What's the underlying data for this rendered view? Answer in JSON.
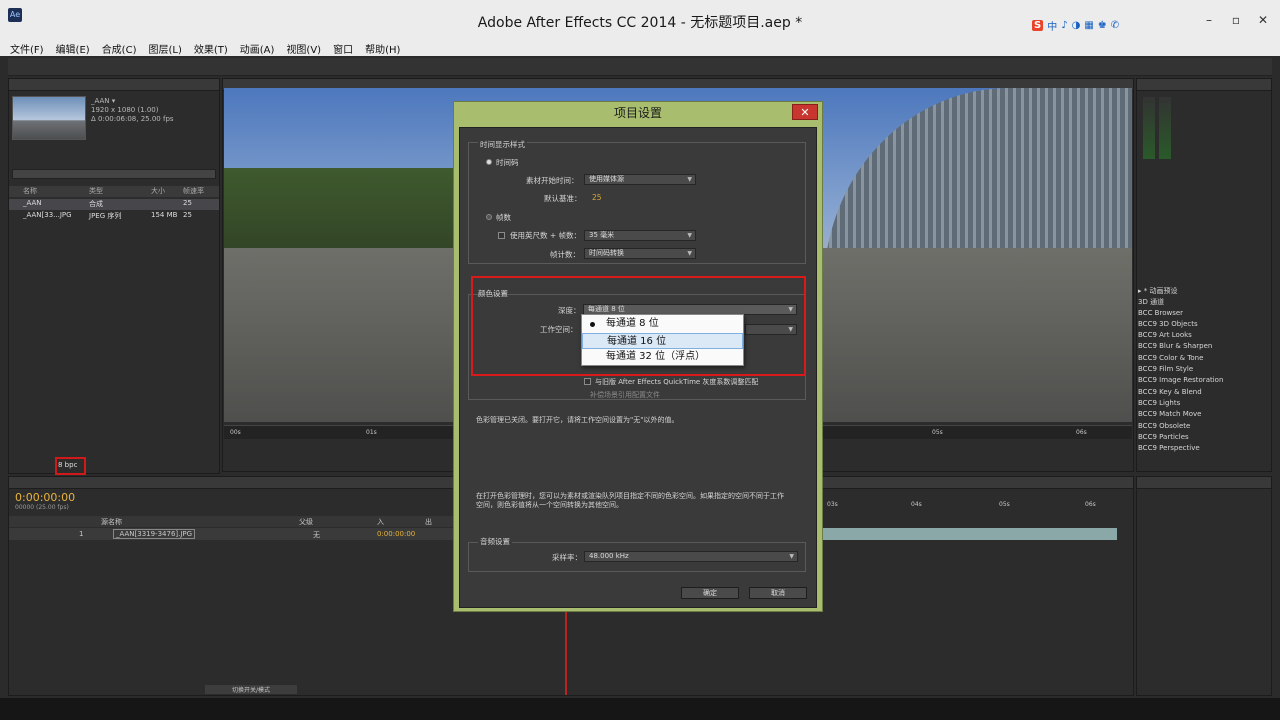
{
  "window": {
    "title": "Adobe After Effects CC 2014 - 无标题项目.aep *",
    "app_icon": "Ae"
  },
  "ime": [
    "S",
    "中",
    "♪",
    "◑",
    "▦",
    "♚",
    "✆"
  ],
  "menu": [
    "文件(F)",
    "编辑(E)",
    "合成(C)",
    "图层(L)",
    "效果(T)",
    "动画(A)",
    "视图(V)",
    "窗口",
    "帮助(H)"
  ],
  "project": {
    "item_name": "_AAN ▾",
    "item_dims": "1920 x 1080 (1.00)",
    "item_dur": "Δ 0:00:06:08, 25.00 fps",
    "columns": [
      "名称",
      "类型",
      "大小",
      "帧速率"
    ],
    "rows": [
      {
        "name": "_AAN",
        "type": "合成",
        "size": "",
        "fps": "25"
      },
      {
        "name": "_AAN[33...JPG",
        "type": "JPEG 序列",
        "size": "154 MB",
        "fps": "25"
      }
    ],
    "bpc": "8 bpc"
  },
  "viewer": {
    "ruler": [
      "00s",
      "01s",
      "05s",
      "06s"
    ]
  },
  "effects": [
    "▸ * 动画预设",
    "3D 通道",
    "BCC Browser",
    "BCC9 3D Objects",
    "BCC9 Art Looks",
    "BCC9 Blur & Sharpen",
    "BCC9 Color & Tone",
    "BCC9 Film Style",
    "BCC9 Image Restoration",
    "BCC9 Key & Blend",
    "BCC9 Lights",
    "BCC9 Match Move",
    "BCC9 Obsolete",
    "BCC9 Particles",
    "BCC9 Perspective"
  ],
  "timeline": {
    "timecode": "0:00:00:00",
    "fps_note": "00000 (25.00 fps)",
    "layer_header": "源名称",
    "parent_header": "父级",
    "in_header": "入",
    "out_header": "出",
    "layer_num": "1",
    "layer_name": "_AAN[3319-3476].JPG",
    "parent_value": "无",
    "in_value": "0:00:00:00",
    "switch_label": "切换开关/模式",
    "ruler": [
      "03s",
      "04s",
      "05s",
      "06s"
    ]
  },
  "dialog": {
    "title": "项目设置",
    "close": "✕",
    "time_group": "时间显示样式",
    "timecode_radio": "时间码",
    "media_start_label": "素材开始时间：",
    "media_start_value": "使用媒体源",
    "default_base_label": "默认基准：",
    "default_base_value": "25",
    "frames_radio": "帧数",
    "feet_label": "使用英尺数 + 帧数：",
    "feet_value": "35 毫米",
    "frame_count_label": "帧计数：",
    "frame_count_value": "时间码转换",
    "color_group": "颜色设置",
    "depth_label": "深度：",
    "depth_value": "每通道 8 位",
    "workspace_label": "工作空间：",
    "depth_options": [
      "每通道 8 位",
      "每通道 16 位",
      "每通道 32 位（浮点）"
    ],
    "match_legacy": "与旧版 After Effects QuickTime 灰度系数调整匹配",
    "compensate": "补偿场景引用配置文件",
    "cm_off_note": "色彩管理已关闭。要打开它，请将工作空间设置为\"无\"以外的值。",
    "cm_on_note": "在打开色彩管理时，您可以为素材或渲染队列项目指定不同的色彩空间。如果指定的空间不同于工作空间，则色彩值将从一个空间转换为其他空间。",
    "audio_group": "音频设置",
    "sample_rate_label": "采样率：",
    "sample_rate_value": "48.000 kHz",
    "ok": "确定",
    "cancel": "取消"
  }
}
